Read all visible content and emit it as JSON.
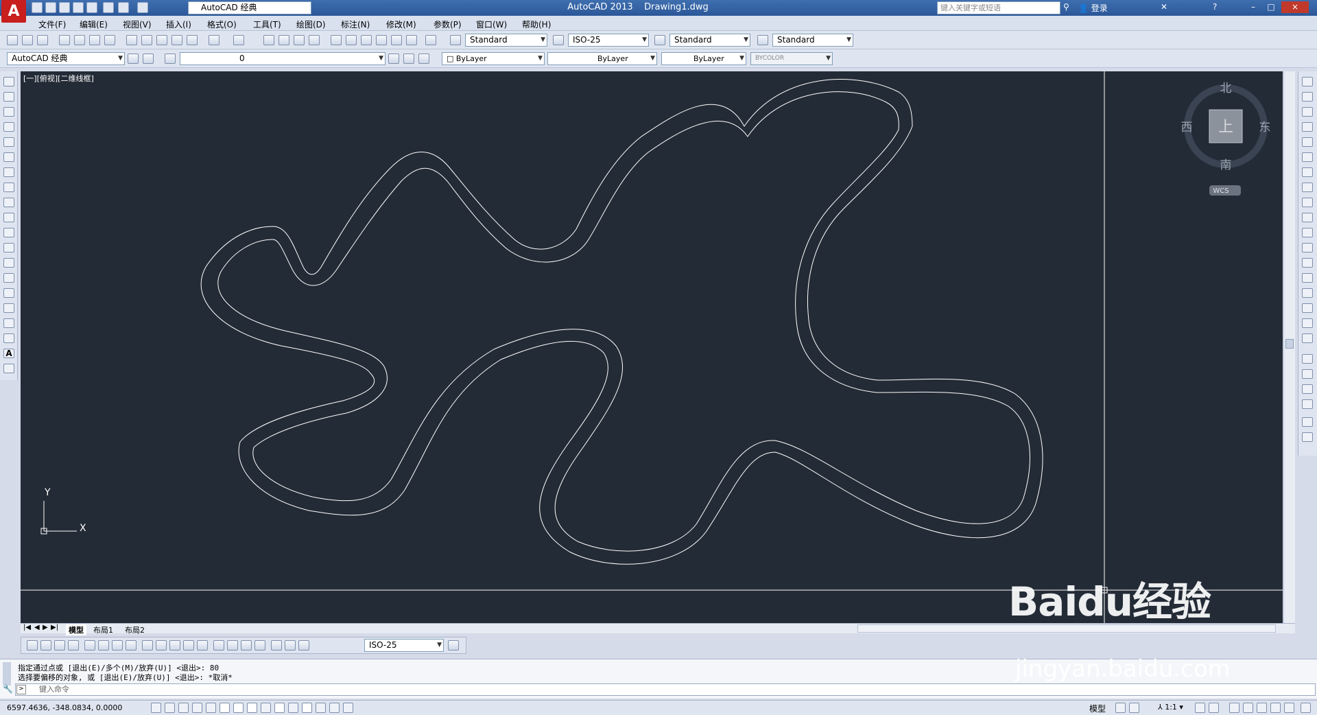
{
  "titlebar": {
    "app_name": "AutoCAD 2013",
    "document": "Drawing1.dwg",
    "workspace": "AutoCAD 经典",
    "search_placeholder": "键入关键字或短语",
    "signin": "登录",
    "min": "–",
    "max": "□",
    "close": "×"
  },
  "menu": [
    "文件(F)",
    "编辑(E)",
    "视图(V)",
    "插入(I)",
    "格式(O)",
    "工具(T)",
    "绘图(D)",
    "标注(N)",
    "修改(M)",
    "参数(P)",
    "窗口(W)",
    "帮助(H)"
  ],
  "styles_toolbar": {
    "text_style": "Standard",
    "dim_style": "ISO-25",
    "table_style": "Standard",
    "mleader_style": "Standard"
  },
  "layers_toolbar": {
    "workspace": "AutoCAD 经典",
    "layer": "0",
    "color": "ByLayer",
    "linetype": "ByLayer",
    "lineweight": "ByLayer",
    "plotstyle": "BYCOLOR"
  },
  "viewport": {
    "label": "[一][俯视][二维线框]",
    "axis_x": "X",
    "axis_y": "Y"
  },
  "viewcube": {
    "north": "北",
    "south": "南",
    "east": "东",
    "west": "西",
    "top": "上",
    "wcs": "WCS"
  },
  "layout_tabs": [
    "模型",
    "布局1",
    "布局2"
  ],
  "dim_toolbar": {
    "dim_style": "ISO-25"
  },
  "command": {
    "line1": "指定通过点或 [退出(E)/多个(M)/放弃(U)] <退出>:  80",
    "line2": "选择要偏移的对象, 或 [退出(E)/放弃(U)] <退出>:  *取消*",
    "placeholder": "键入命令"
  },
  "status": {
    "coords": "6597.4636, -348.0834, 0.0000",
    "model": "模型",
    "scale": "1:1"
  },
  "watermark": {
    "brand": "Baidu经验",
    "url": "jingyan.baidu.com"
  }
}
